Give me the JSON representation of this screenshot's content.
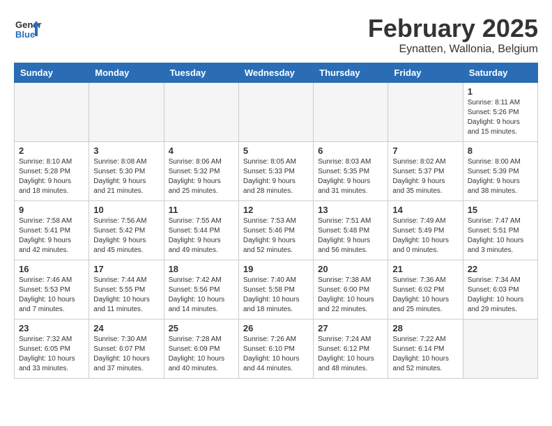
{
  "header": {
    "logo": "General Blue",
    "title": "February 2025",
    "subtitle": "Eynatten, Wallonia, Belgium"
  },
  "days_of_week": [
    "Sunday",
    "Monday",
    "Tuesday",
    "Wednesday",
    "Thursday",
    "Friday",
    "Saturday"
  ],
  "weeks": [
    [
      {
        "num": "",
        "info": ""
      },
      {
        "num": "",
        "info": ""
      },
      {
        "num": "",
        "info": ""
      },
      {
        "num": "",
        "info": ""
      },
      {
        "num": "",
        "info": ""
      },
      {
        "num": "",
        "info": ""
      },
      {
        "num": "1",
        "info": "Sunrise: 8:11 AM\nSunset: 5:26 PM\nDaylight: 9 hours and 15 minutes."
      }
    ],
    [
      {
        "num": "2",
        "info": "Sunrise: 8:10 AM\nSunset: 5:28 PM\nDaylight: 9 hours and 18 minutes."
      },
      {
        "num": "3",
        "info": "Sunrise: 8:08 AM\nSunset: 5:30 PM\nDaylight: 9 hours and 21 minutes."
      },
      {
        "num": "4",
        "info": "Sunrise: 8:06 AM\nSunset: 5:32 PM\nDaylight: 9 hours and 25 minutes."
      },
      {
        "num": "5",
        "info": "Sunrise: 8:05 AM\nSunset: 5:33 PM\nDaylight: 9 hours and 28 minutes."
      },
      {
        "num": "6",
        "info": "Sunrise: 8:03 AM\nSunset: 5:35 PM\nDaylight: 9 hours and 31 minutes."
      },
      {
        "num": "7",
        "info": "Sunrise: 8:02 AM\nSunset: 5:37 PM\nDaylight: 9 hours and 35 minutes."
      },
      {
        "num": "8",
        "info": "Sunrise: 8:00 AM\nSunset: 5:39 PM\nDaylight: 9 hours and 38 minutes."
      }
    ],
    [
      {
        "num": "9",
        "info": "Sunrise: 7:58 AM\nSunset: 5:41 PM\nDaylight: 9 hours and 42 minutes."
      },
      {
        "num": "10",
        "info": "Sunrise: 7:56 AM\nSunset: 5:42 PM\nDaylight: 9 hours and 45 minutes."
      },
      {
        "num": "11",
        "info": "Sunrise: 7:55 AM\nSunset: 5:44 PM\nDaylight: 9 hours and 49 minutes."
      },
      {
        "num": "12",
        "info": "Sunrise: 7:53 AM\nSunset: 5:46 PM\nDaylight: 9 hours and 52 minutes."
      },
      {
        "num": "13",
        "info": "Sunrise: 7:51 AM\nSunset: 5:48 PM\nDaylight: 9 hours and 56 minutes."
      },
      {
        "num": "14",
        "info": "Sunrise: 7:49 AM\nSunset: 5:49 PM\nDaylight: 10 hours and 0 minutes."
      },
      {
        "num": "15",
        "info": "Sunrise: 7:47 AM\nSunset: 5:51 PM\nDaylight: 10 hours and 3 minutes."
      }
    ],
    [
      {
        "num": "16",
        "info": "Sunrise: 7:46 AM\nSunset: 5:53 PM\nDaylight: 10 hours and 7 minutes."
      },
      {
        "num": "17",
        "info": "Sunrise: 7:44 AM\nSunset: 5:55 PM\nDaylight: 10 hours and 11 minutes."
      },
      {
        "num": "18",
        "info": "Sunrise: 7:42 AM\nSunset: 5:56 PM\nDaylight: 10 hours and 14 minutes."
      },
      {
        "num": "19",
        "info": "Sunrise: 7:40 AM\nSunset: 5:58 PM\nDaylight: 10 hours and 18 minutes."
      },
      {
        "num": "20",
        "info": "Sunrise: 7:38 AM\nSunset: 6:00 PM\nDaylight: 10 hours and 22 minutes."
      },
      {
        "num": "21",
        "info": "Sunrise: 7:36 AM\nSunset: 6:02 PM\nDaylight: 10 hours and 25 minutes."
      },
      {
        "num": "22",
        "info": "Sunrise: 7:34 AM\nSunset: 6:03 PM\nDaylight: 10 hours and 29 minutes."
      }
    ],
    [
      {
        "num": "23",
        "info": "Sunrise: 7:32 AM\nSunset: 6:05 PM\nDaylight: 10 hours and 33 minutes."
      },
      {
        "num": "24",
        "info": "Sunrise: 7:30 AM\nSunset: 6:07 PM\nDaylight: 10 hours and 37 minutes."
      },
      {
        "num": "25",
        "info": "Sunrise: 7:28 AM\nSunset: 6:09 PM\nDaylight: 10 hours and 40 minutes."
      },
      {
        "num": "26",
        "info": "Sunrise: 7:26 AM\nSunset: 6:10 PM\nDaylight: 10 hours and 44 minutes."
      },
      {
        "num": "27",
        "info": "Sunrise: 7:24 AM\nSunset: 6:12 PM\nDaylight: 10 hours and 48 minutes."
      },
      {
        "num": "28",
        "info": "Sunrise: 7:22 AM\nSunset: 6:14 PM\nDaylight: 10 hours and 52 minutes."
      },
      {
        "num": "",
        "info": ""
      }
    ]
  ]
}
